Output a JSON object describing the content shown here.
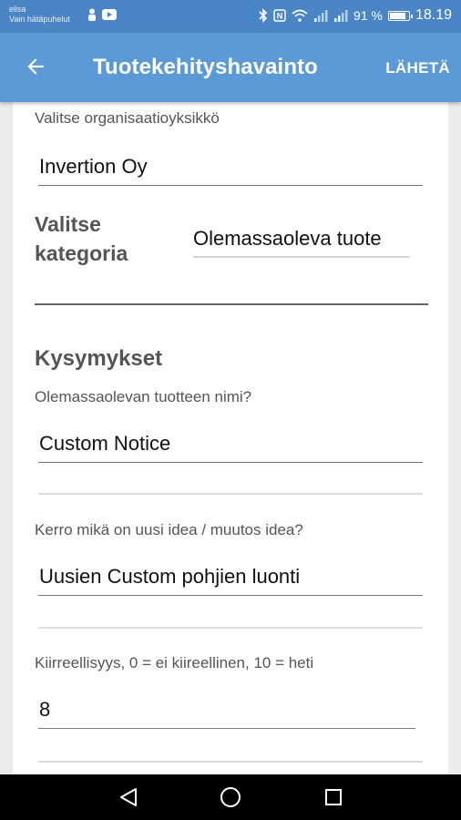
{
  "status_bar": {
    "carrier_line1": "elisa",
    "carrier_line2": "Vain hätäpuhelut",
    "battery_text": "91 %",
    "battery_level": 0.91,
    "time": "18.19",
    "icons": [
      "person-icon",
      "youtube-icon",
      "bluetooth-icon",
      "nfc-icon",
      "wifi-icon",
      "signal-icon",
      "signal-icon",
      "battery-icon"
    ]
  },
  "app_bar": {
    "title": "Tuotekehityshavainto",
    "send_label": "LÄHETÄ",
    "back_icon": "arrow-back-icon"
  },
  "form": {
    "org_label": "Valitse organisaatioyksikkö",
    "org_value": "Invertion Oy",
    "category_label_1": "Valitse",
    "category_label_2": "kategoria",
    "category_value": "Olemassaoleva tuote",
    "section_title": "Kysymykset",
    "q1_label": "Olemassaolevan tuotteen nimi?",
    "q1_value": "Custom Notice",
    "q2_label": "Kerro mikä on uusi idea / muutos idea?",
    "q2_value": "Uusien Custom pohjien luonti",
    "q3_label": "Kiirreellisyys, 0 = ei kiireellinen, 10 = heti",
    "q3_value": "8"
  },
  "nav_bar": {
    "icons": [
      "back-triangle-icon",
      "home-circle-icon",
      "recents-square-icon"
    ]
  },
  "colors": {
    "status_bar": "#4a86c5",
    "app_bar": "#5b9ad6",
    "background": "#ececec"
  }
}
